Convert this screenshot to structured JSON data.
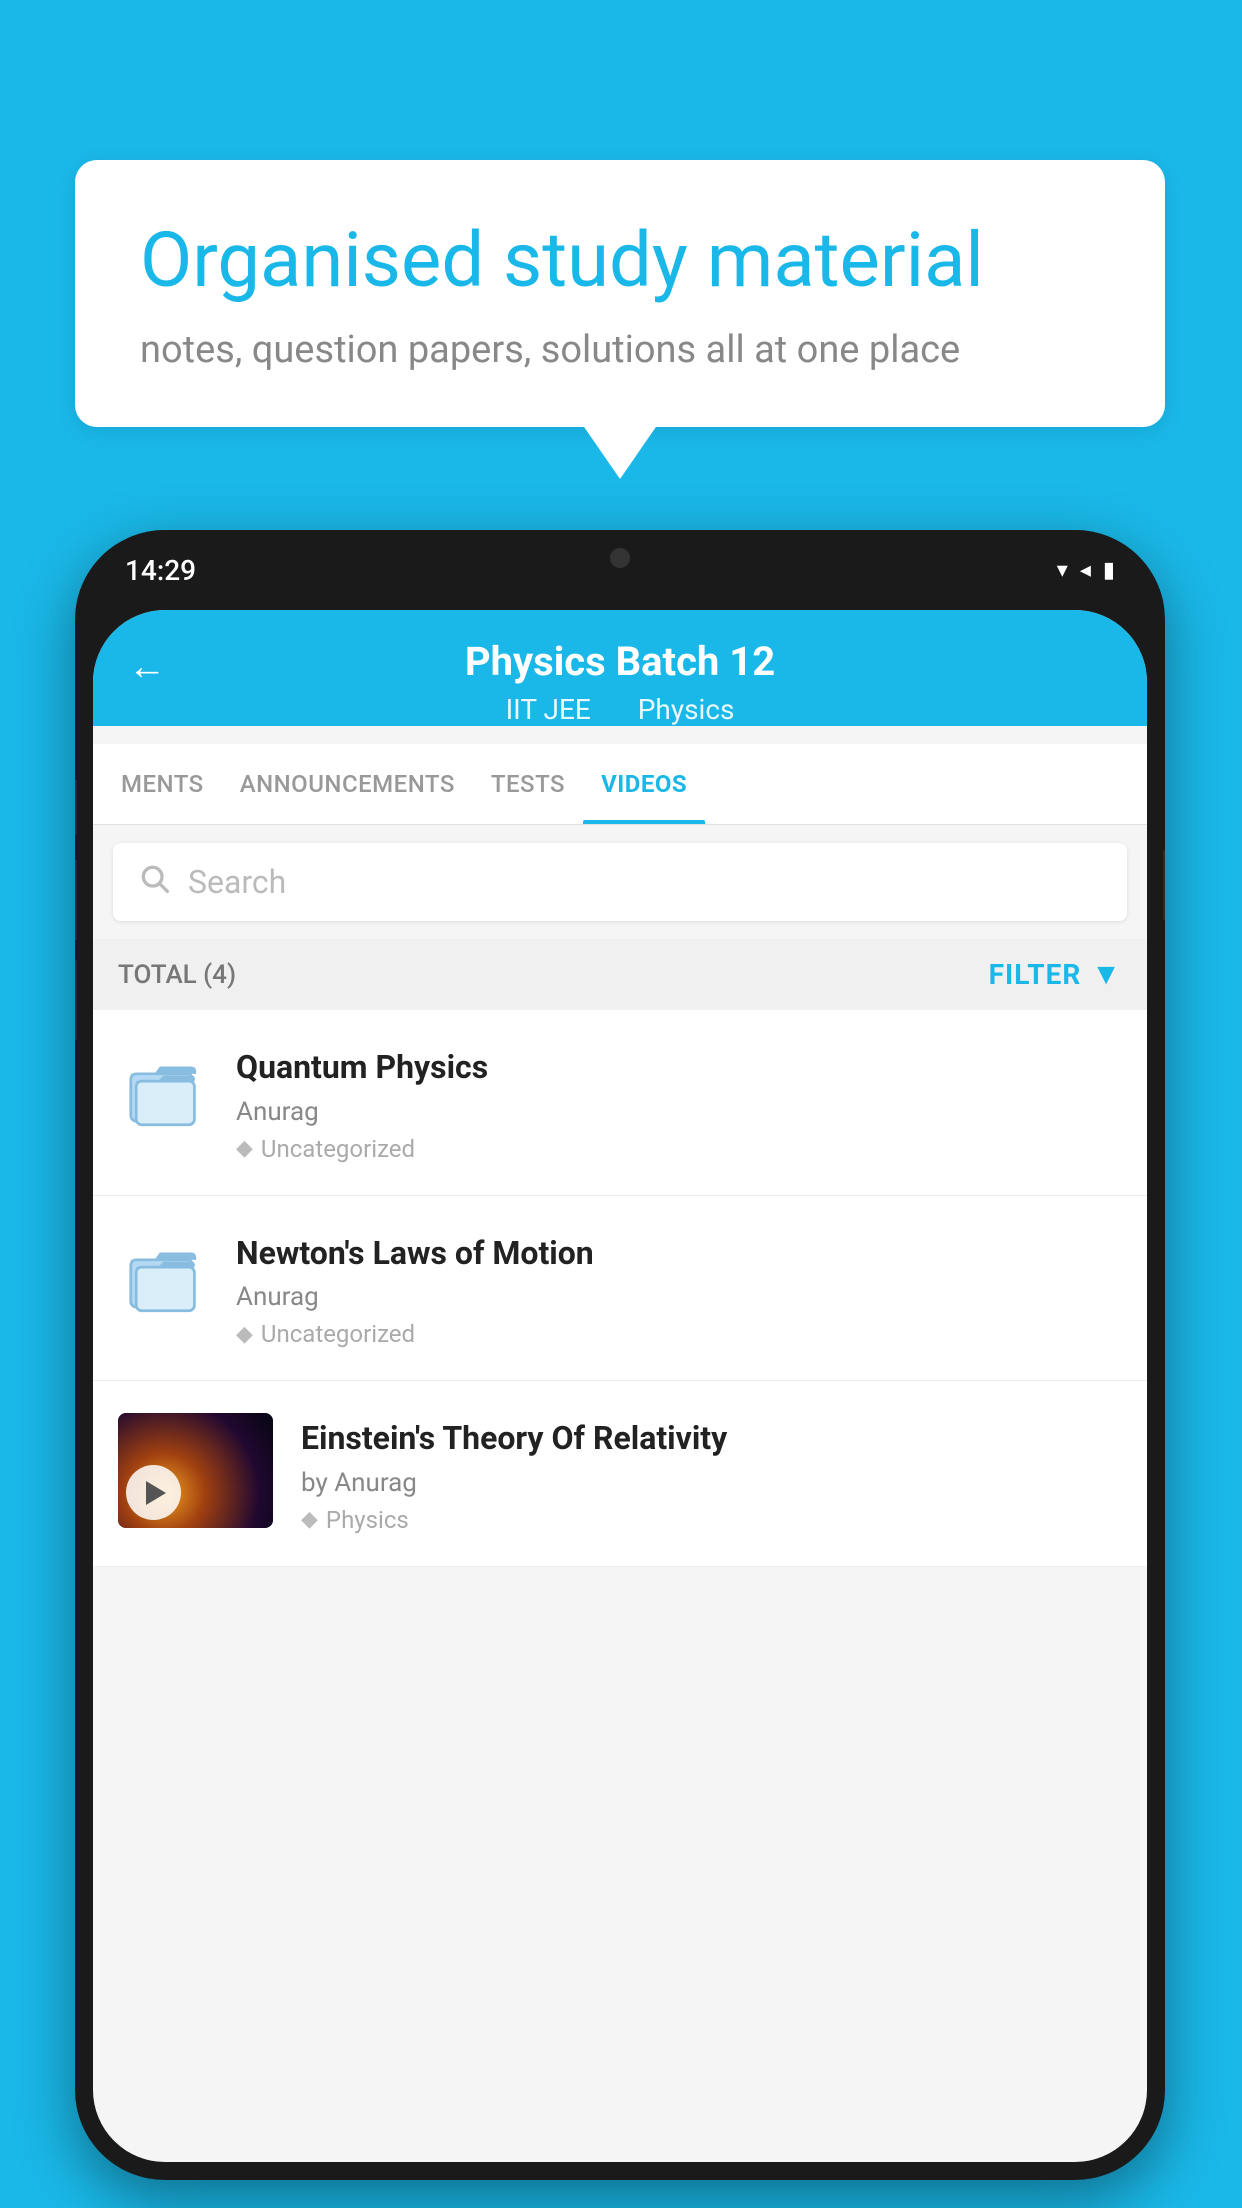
{
  "bubble": {
    "title": "Organised study material",
    "subtitle": "notes, question papers, solutions all at one place"
  },
  "status_bar": {
    "time": "14:29",
    "wifi": "▼",
    "signal": "◀",
    "battery": "▮"
  },
  "app_header": {
    "title": "Physics Batch 12",
    "subtitle_category": "IIT JEE",
    "subtitle_subject": "Physics",
    "back_label": "←"
  },
  "tabs": [
    {
      "label": "MENTS",
      "active": false
    },
    {
      "label": "ANNOUNCEMENTS",
      "active": false
    },
    {
      "label": "TESTS",
      "active": false
    },
    {
      "label": "VIDEOS",
      "active": true
    }
  ],
  "search": {
    "placeholder": "Search"
  },
  "filter_bar": {
    "total_label": "TOTAL (4)",
    "filter_label": "FILTER"
  },
  "videos": [
    {
      "id": 1,
      "title": "Quantum Physics",
      "author": "Anurag",
      "tag": "Uncategorized",
      "has_thumb": false
    },
    {
      "id": 2,
      "title": "Newton's Laws of Motion",
      "author": "Anurag",
      "tag": "Uncategorized",
      "has_thumb": false
    },
    {
      "id": 3,
      "title": "Einstein's Theory Of Relativity",
      "author": "by Anurag",
      "tag": "Physics",
      "has_thumb": true
    }
  ]
}
